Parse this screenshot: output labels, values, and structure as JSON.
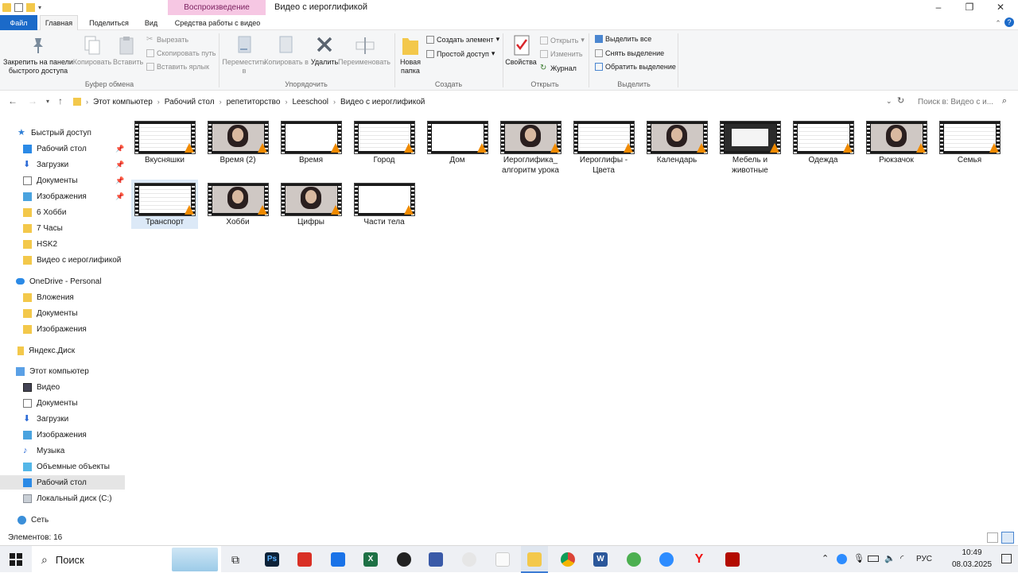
{
  "window": {
    "title": "Видео с иероглификой",
    "context_tab": "Воспроизведение"
  },
  "tabs": [
    "Файл",
    "Главная",
    "Поделиться",
    "Вид",
    "Средства работы с видео"
  ],
  "ribbon": {
    "clipboard": {
      "pin": "Закрепить на панели быстрого доступа",
      "copy": "Копировать",
      "paste": "Вставить",
      "cut": "Вырезать",
      "copy_path": "Скопировать путь",
      "paste_shortcut": "Вставить ярлык",
      "group": "Буфер обмена"
    },
    "organize": {
      "move": "Переместить в",
      "copy_to": "Копировать в",
      "delete": "Удалить",
      "rename": "Переименовать",
      "group": "Упорядочить"
    },
    "create": {
      "new_folder": "Новая папка",
      "new_item": "Создать элемент",
      "easy_access": "Простой доступ",
      "group": "Создать"
    },
    "open": {
      "properties": "Свойства",
      "open": "Открыть",
      "edit": "Изменить",
      "history": "Журнал",
      "group": "Открыть"
    },
    "select": {
      "select_all": "Выделить все",
      "select_none": "Снять выделение",
      "invert": "Обратить выделение",
      "group": "Выделить"
    }
  },
  "address": {
    "crumbs": [
      "Этот компьютер",
      "Рабочий стол",
      "репетиторство",
      "Leeschool",
      "Видео с иероглификой"
    ],
    "search_placeholder": "Поиск в: Видео с и..."
  },
  "nav": {
    "quick_access": "Быстрый доступ",
    "qa_items": [
      "Рабочий стол",
      "Загрузки",
      "Документы",
      "Изображения",
      "6 Хобби",
      "7 Часы",
      "HSK2",
      "Видео с иероглификой"
    ],
    "onedrive": "OneDrive - Personal",
    "od_items": [
      "Вложения",
      "Документы",
      "Изображения"
    ],
    "yandex": "Яндекс.Диск",
    "this_pc": "Этот компьютер",
    "pc_items": [
      "Видео",
      "Документы",
      "Загрузки",
      "Изображения",
      "Музыка",
      "Объемные объекты",
      "Рабочий стол",
      "Локальный диск (C:)"
    ],
    "network": "Сеть"
  },
  "files": [
    {
      "name": "Вкусняшки",
      "kind": "doc"
    },
    {
      "name": "Время (2)",
      "kind": "face"
    },
    {
      "name": "Время",
      "kind": "blank"
    },
    {
      "name": "Город",
      "kind": "doc"
    },
    {
      "name": "Дом",
      "kind": "blank"
    },
    {
      "name": "Иероглифика_ алгоритм урока",
      "kind": "face"
    },
    {
      "name": "Иероглифы - Цвета",
      "kind": "doc"
    },
    {
      "name": "Календарь",
      "kind": "face"
    },
    {
      "name": "Мебель и животные",
      "kind": "screen"
    },
    {
      "name": "Одежда",
      "kind": "doc"
    },
    {
      "name": "Рюкзачок",
      "kind": "face"
    },
    {
      "name": "Семья",
      "kind": "doc"
    },
    {
      "name": "Транспорт",
      "kind": "doc"
    },
    {
      "name": "Хобби",
      "kind": "face"
    },
    {
      "name": "Цифры",
      "kind": "face"
    },
    {
      "name": "Части тела",
      "kind": "blank"
    }
  ],
  "status": {
    "count": "Элементов: 16"
  },
  "taskbar": {
    "search": "Поиск",
    "lang": "РУС",
    "time": "10:49",
    "date": "08.03.2025"
  }
}
